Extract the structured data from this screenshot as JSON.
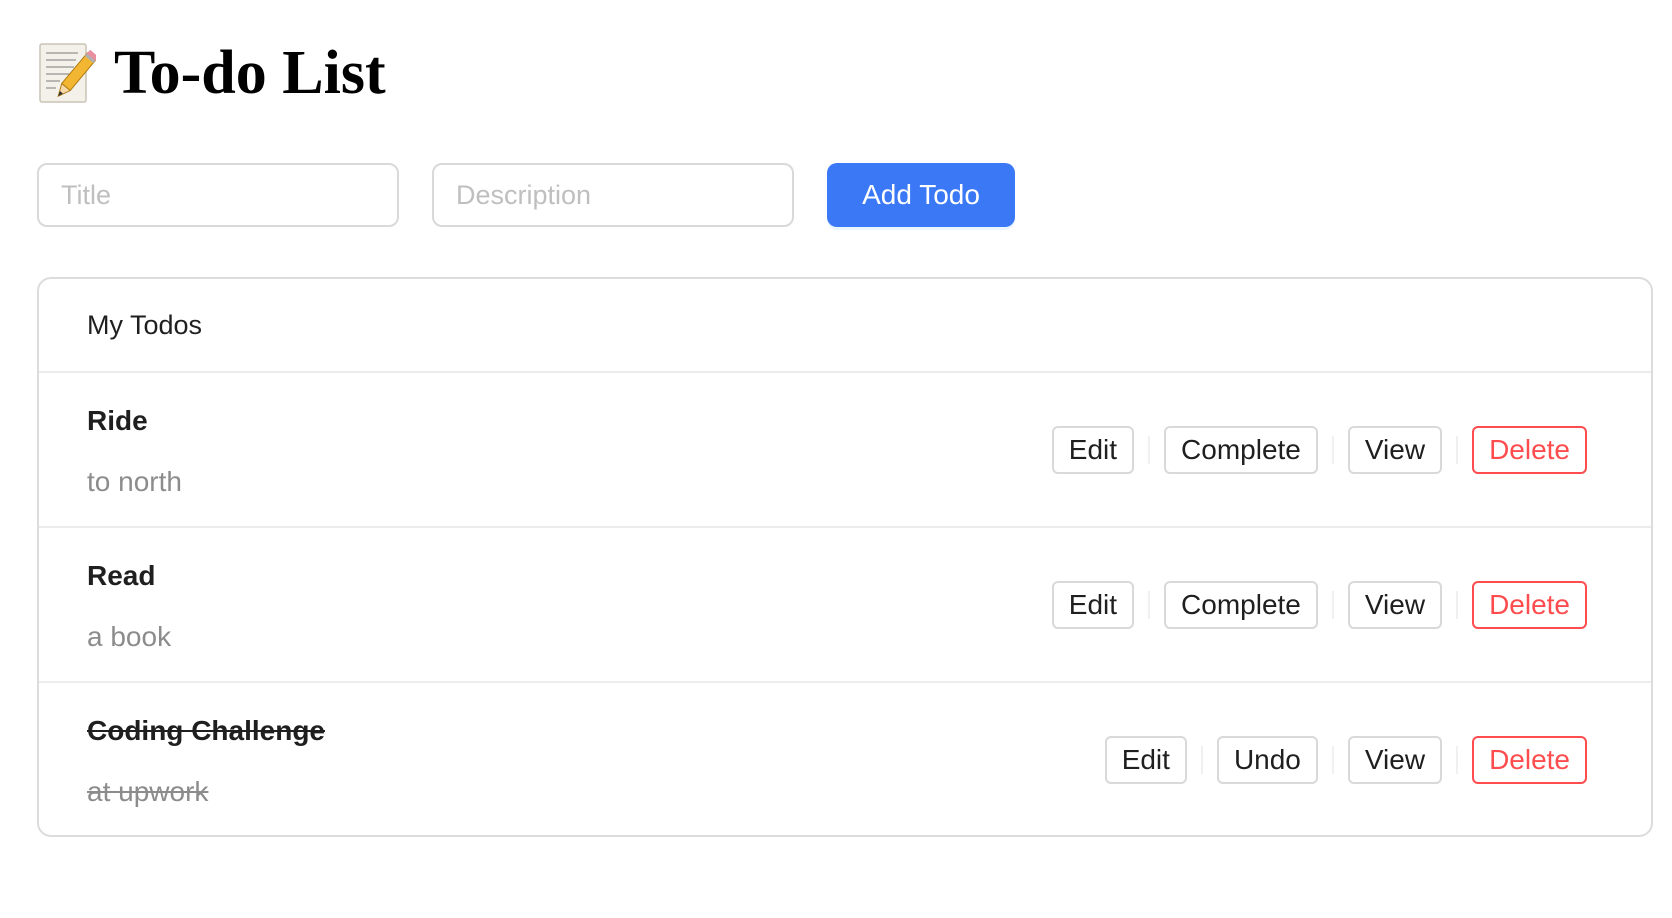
{
  "header": {
    "icon": "memo-notepad-icon",
    "title": "To-do List"
  },
  "form": {
    "title_placeholder": "Title",
    "title_value": "",
    "description_placeholder": "Description",
    "description_value": "",
    "add_label": "Add Todo"
  },
  "list": {
    "header": "My Todos",
    "items": [
      {
        "title": "Ride",
        "description": "to north",
        "completed": false,
        "actions": {
          "edit": "Edit",
          "toggle": "Complete",
          "view": "View",
          "delete": "Delete"
        }
      },
      {
        "title": "Read",
        "description": "a book",
        "completed": false,
        "actions": {
          "edit": "Edit",
          "toggle": "Complete",
          "view": "View",
          "delete": "Delete"
        }
      },
      {
        "title": "Coding Challenge",
        "description": "at upwork",
        "completed": true,
        "actions": {
          "edit": "Edit",
          "toggle": "Undo",
          "view": "View",
          "delete": "Delete"
        }
      }
    ]
  },
  "colors": {
    "primary": "#3b78f5",
    "danger": "#ff4d4f",
    "border": "#d9d9d9",
    "muted_text": "#8c8c8c"
  }
}
